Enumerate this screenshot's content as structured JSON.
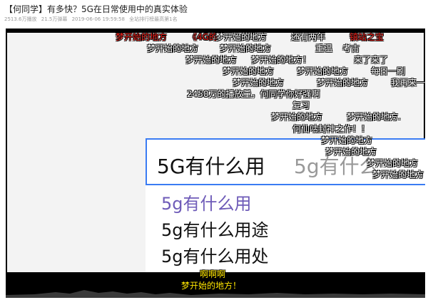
{
  "video": {
    "title": "【何同学】有多快？5G在日常使用中的真实体验",
    "meta": {
      "plays": "2513.6万播放",
      "danmaku": "21.5万弹幕",
      "date": "2019-06-06 19:59:58",
      "rank": "全站排行榜最高第1名"
    }
  },
  "screen": {
    "query": "5G有什么用",
    "query_ghost": "5g有什么",
    "suggestions": [
      "5g有什么用",
      "5g有什么用途",
      "5g有什么用处"
    ]
  },
  "danmaku": [
    {
      "text": "梦开始的地方",
      "color": "red"
    },
    {
      "text": "《4G的",
      "color": "red"
    },
    {
      "text": "梦开始的地方",
      "color": "white"
    },
    {
      "text": "还有两年",
      "color": "white"
    },
    {
      "text": "镇站之宝",
      "color": "red"
    },
    {
      "text": "梦开始的地方",
      "color": "white"
    },
    {
      "text": "梦开始的地方",
      "color": "white"
    },
    {
      "text": "重温",
      "color": "white"
    },
    {
      "text": "考古",
      "color": "white"
    },
    {
      "text": "梦开始的地方",
      "color": "white"
    },
    {
      "text": "梦开始的地方！",
      "color": "white"
    },
    {
      "text": "来了来了",
      "color": "white"
    },
    {
      "text": "梦开始的地方",
      "color": "white"
    },
    {
      "text": "梦开始的地方",
      "color": "white"
    },
    {
      "text": "每日一刷",
      "color": "white"
    },
    {
      "text": "梦开始的地方",
      "color": "white"
    },
    {
      "text": "梦开始的地方",
      "color": "white"
    },
    {
      "text": "我再来一",
      "color": "white"
    },
    {
      "text": "2450万的播放量，何同学你好强啊",
      "color": "white"
    },
    {
      "text": "复习",
      "color": "white"
    },
    {
      "text": "梦开始的地方",
      "color": "white"
    },
    {
      "text": "梦开始的地方.",
      "color": "white"
    },
    {
      "text": "何仙咕封神之作！！",
      "color": "white"
    },
    {
      "text": "梦开始的地方",
      "color": "white"
    },
    {
      "text": "梦开始的地方",
      "color": "white"
    },
    {
      "text": "梦开始的地方",
      "color": "white"
    },
    {
      "text": "梦开始的地方",
      "color": "white"
    },
    {
      "text": "啊啊啊",
      "color": "yellow"
    },
    {
      "text": "梦开始的地方！",
      "color": "yellow"
    }
  ]
}
